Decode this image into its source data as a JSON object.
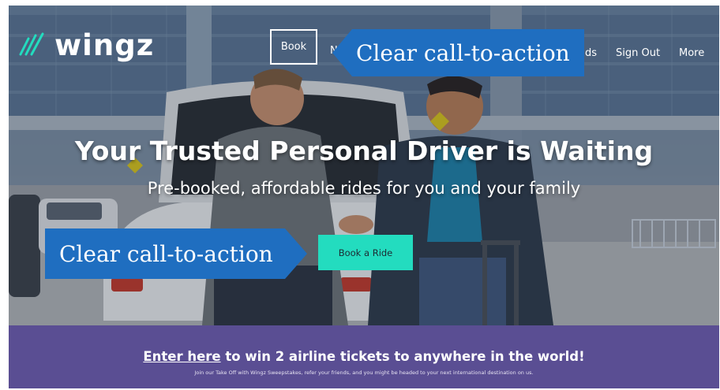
{
  "brand": {
    "logo_text": "wingz"
  },
  "nav": {
    "book": "Book",
    "truncated_left": "N",
    "truncated_right": "ds",
    "sign_out": "Sign Out",
    "more": "More"
  },
  "hero": {
    "headline": "Your Trusted Personal Driver is Waiting",
    "subhead": "Pre-booked, affordable rides for you and your family",
    "cta": "Book a Ride"
  },
  "annotations": {
    "top": "Clear call-to-action",
    "bottom": "Clear call-to-action"
  },
  "promo": {
    "link_text": "Enter here",
    "text": " to win 2 airline tickets to anywhere in the world!",
    "small": "Join our Take Off with Wingz Sweepstakes, refer your friends, and you might be headed to your next international destination on us."
  },
  "colors": {
    "accent": "#23dcbf",
    "callout": "#1f6ec0",
    "promo_bg": "#5a4e93"
  },
  "icons": [
    "wingz-logo-icon"
  ]
}
